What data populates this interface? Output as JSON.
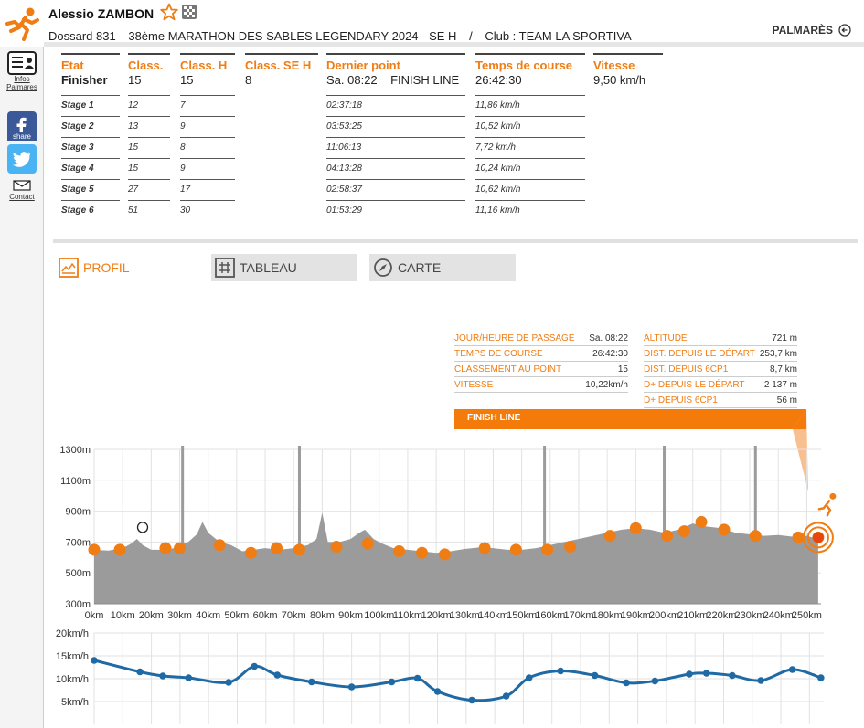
{
  "header": {
    "name": "Alessio ZAMBON",
    "dossard": "Dossard 831",
    "race": "38ème MARATHON DES SABLES LEGENDARY 2024 - SE H",
    "separator": "/",
    "club": "Club : TEAM LA SPORTIVA",
    "palmares": "PALMARÈS"
  },
  "sidebar": {
    "infos_line1": "Infos",
    "infos_line2": "Palmares",
    "share": "share",
    "contact": "Contact"
  },
  "results": {
    "columns": [
      {
        "head": "Etat",
        "main": "Finisher",
        "cells": [
          "Stage 1",
          "Stage 2",
          "Stage 3",
          "Stage 4",
          "Stage 5",
          "Stage 6"
        ]
      },
      {
        "head": "Class.",
        "main": "15",
        "cells": [
          "12",
          "13",
          "15",
          "15",
          "27",
          "51"
        ]
      },
      {
        "head": "Class. H",
        "main": "15",
        "cells": [
          "7",
          "9",
          "8",
          "9",
          "17",
          "30"
        ]
      },
      {
        "head": "Class. SE H",
        "main": "8",
        "cells": []
      },
      {
        "head": "Dernier point",
        "main": "Sa. 08:22    FINISH LINE",
        "cells": [
          "02:37:18",
          "03:53:25",
          "11:06:13",
          "04:13:28",
          "02:58:37",
          "01:53:29"
        ]
      },
      {
        "head": "Temps de course",
        "main": "26:42:30",
        "cells": [
          "11,86 km/h",
          "10,52 km/h",
          "7,72 km/h",
          "10,24 km/h",
          "10,62 km/h",
          "11,16 km/h"
        ]
      },
      {
        "head": "Vitesse",
        "main": "9,50 km/h",
        "cells": []
      }
    ]
  },
  "tabs": {
    "profil": "PROFIL",
    "tableau": "TABLEAU",
    "carte": "CARTE"
  },
  "info_panel": {
    "left": [
      {
        "label": "JOUR/HEURE DE PASSAGE",
        "value": "Sa. 08:22"
      },
      {
        "label": "TEMPS DE COURSE",
        "value": "26:42:30"
      },
      {
        "label": "CLASSEMENT AU POINT",
        "value": "15"
      },
      {
        "label": "VITESSE",
        "value": "10,22km/h"
      }
    ],
    "right": [
      {
        "label": "ALTITUDE",
        "value": "721 m"
      },
      {
        "label": "DIST. DEPUIS LE DÉPART",
        "value": "253,7 km"
      },
      {
        "label": "DIST. DEPUIS 6CP1",
        "value": "8,7 km"
      },
      {
        "label": "D+ DEPUIS LE DÉPART",
        "value": "2 137 m"
      },
      {
        "label": "D+ DEPUIS 6CP1",
        "value": "56 m"
      }
    ],
    "point": "FINISH LINE"
  },
  "colors": {
    "accent": "#f07d14",
    "profile_fill": "#9b9b9b",
    "speed_line": "#1f6aa5"
  },
  "chart_data": [
    {
      "type": "area",
      "title": "",
      "xlabel": "",
      "ylabel": "",
      "x_unit": "km",
      "y_unit": "m",
      "xlim": [
        0,
        255
      ],
      "ylim": [
        300,
        1300
      ],
      "x_ticks": [
        "0km",
        "10km",
        "20km",
        "30km",
        "40km",
        "50km",
        "60km",
        "70km",
        "80km",
        "90km",
        "100km",
        "110km",
        "120km",
        "130km",
        "140km",
        "150km",
        "160km",
        "170km",
        "180km",
        "190km",
        "200km",
        "210km",
        "220km",
        "230km",
        "240km",
        "250km"
      ],
      "y_ticks": [
        "1300m",
        "1100m",
        "900m",
        "700m",
        "500m",
        "300m"
      ],
      "grid": true,
      "profile": [
        [
          0,
          650
        ],
        [
          5,
          645
        ],
        [
          10,
          660
        ],
        [
          13,
          690
        ],
        [
          15,
          720
        ],
        [
          17,
          680
        ],
        [
          20,
          650
        ],
        [
          25,
          650
        ],
        [
          28,
          660
        ],
        [
          30,
          680
        ],
        [
          33,
          700
        ],
        [
          36,
          750
        ],
        [
          38,
          830
        ],
        [
          40,
          760
        ],
        [
          44,
          700
        ],
        [
          48,
          680
        ],
        [
          52,
          640
        ],
        [
          56,
          650
        ],
        [
          60,
          660
        ],
        [
          65,
          650
        ],
        [
          70,
          660
        ],
        [
          75,
          680
        ],
        [
          78,
          720
        ],
        [
          80,
          890
        ],
        [
          82,
          700
        ],
        [
          86,
          700
        ],
        [
          90,
          720
        ],
        [
          93,
          760
        ],
        [
          95,
          780
        ],
        [
          98,
          720
        ],
        [
          101,
          690
        ],
        [
          105,
          660
        ],
        [
          110,
          650
        ],
        [
          115,
          640
        ],
        [
          120,
          630
        ],
        [
          125,
          640
        ],
        [
          130,
          655
        ],
        [
          135,
          665
        ],
        [
          140,
          660
        ],
        [
          145,
          650
        ],
        [
          150,
          650
        ],
        [
          155,
          660
        ],
        [
          160,
          680
        ],
        [
          165,
          700
        ],
        [
          170,
          720
        ],
        [
          175,
          740
        ],
        [
          180,
          760
        ],
        [
          185,
          780
        ],
        [
          190,
          790
        ],
        [
          195,
          780
        ],
        [
          200,
          760
        ],
        [
          205,
          780
        ],
        [
          210,
          820
        ],
        [
          215,
          800
        ],
        [
          220,
          790
        ],
        [
          225,
          760
        ],
        [
          230,
          750
        ],
        [
          235,
          740
        ],
        [
          240,
          745
        ],
        [
          245,
          735
        ],
        [
          250,
          740
        ],
        [
          254,
          720
        ]
      ],
      "checkpoints": [
        [
          0,
          650
        ],
        [
          9,
          650
        ],
        [
          25,
          660
        ],
        [
          30,
          660
        ],
        [
          44,
          680
        ],
        [
          55,
          630
        ],
        [
          64,
          660
        ],
        [
          72,
          650
        ],
        [
          85,
          670
        ],
        [
          96,
          690
        ],
        [
          107,
          640
        ],
        [
          115,
          630
        ],
        [
          123,
          620
        ],
        [
          137,
          660
        ],
        [
          148,
          650
        ],
        [
          159,
          650
        ],
        [
          167,
          670
        ],
        [
          181,
          740
        ],
        [
          190,
          790
        ],
        [
          201,
          740
        ],
        [
          207,
          770
        ],
        [
          213,
          830
        ],
        [
          221,
          780
        ],
        [
          232,
          740
        ],
        [
          247,
          730
        ],
        [
          254,
          730
        ]
      ],
      "stage_markers_km": [
        31,
        72,
        158,
        200,
        232
      ],
      "current_km": 254
    },
    {
      "type": "line",
      "title": "",
      "xlabel": "",
      "ylabel": "",
      "y_unit": "km/h",
      "xlim": [
        0,
        255
      ],
      "ylim": [
        0,
        20
      ],
      "y_ticks": [
        "20km/h",
        "15km/h",
        "10km/h",
        "5km/h"
      ],
      "series": [
        {
          "values": [
            [
              0,
              14.0
            ],
            [
              16,
              11.5
            ],
            [
              24,
              10.6
            ],
            [
              33,
              10.2
            ],
            [
              47,
              9.2
            ],
            [
              56,
              12.7
            ],
            [
              64,
              10.8
            ],
            [
              76,
              9.3
            ],
            [
              90,
              8.2
            ],
            [
              104,
              9.3
            ],
            [
              113,
              10.1
            ],
            [
              120,
              7.2
            ],
            [
              132,
              5.3
            ],
            [
              144,
              6.2
            ],
            [
              152,
              10.2
            ],
            [
              163,
              11.7
            ],
            [
              175,
              10.7
            ],
            [
              186,
              9.1
            ],
            [
              196,
              9.5
            ],
            [
              208,
              11.0
            ],
            [
              214,
              11.2
            ],
            [
              223,
              10.7
            ],
            [
              233,
              9.6
            ],
            [
              244,
              12.0
            ],
            [
              254,
              10.2
            ]
          ]
        }
      ]
    }
  ]
}
